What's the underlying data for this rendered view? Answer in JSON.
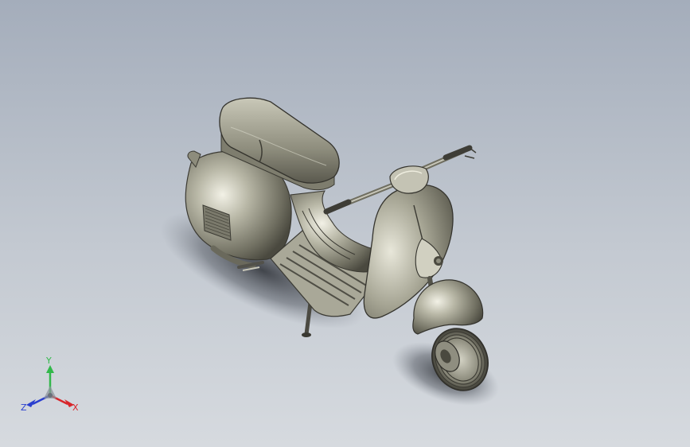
{
  "viewport": {
    "background_top": "#a4adbb",
    "background_bottom": "#d6dadf"
  },
  "model": {
    "icon": "scooter-3d-model",
    "body_color": "#9b9a8c"
  },
  "triad": {
    "x_label": "X",
    "y_label": "Y",
    "z_label": "Z",
    "x_color": "#d8262b",
    "y_color": "#32b84a",
    "z_color": "#2a3fcf"
  }
}
